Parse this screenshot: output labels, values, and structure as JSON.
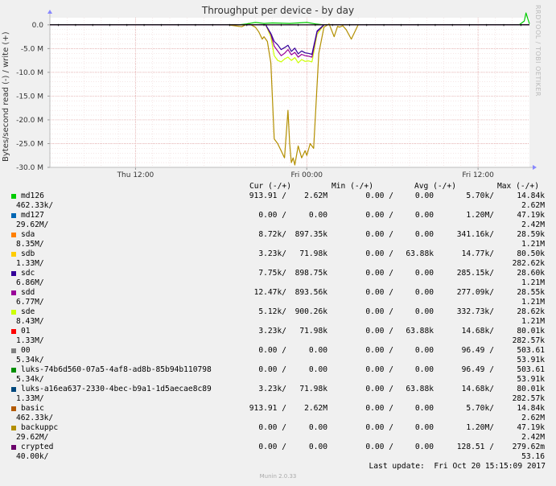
{
  "title": "Throughput per device - by day",
  "watermark": "RRDTOOL / TOBI OETIKER",
  "footer": "Munin 2.0.33",
  "last_update": "Last update:  Fri Oct 20 15:15:09 2017",
  "legend_headers": {
    "cur": "Cur (-/+)",
    "min": "Min (-/+)",
    "avg": "Avg (-/+)",
    "max": "Max (-/+)"
  },
  "legend": [
    {
      "name": "md126",
      "color": "#00cc00",
      "cur": "913.91 /",
      "cur2": "2.62M",
      "min": "0.00 /",
      "min2": "0.00",
      "avg": "5.70k/",
      "max": "14.84k",
      "cont_left": "462.33k/",
      "cont_right": "2.62M"
    },
    {
      "name": "md127",
      "color": "#0066b3",
      "cur": "0.00 /",
      "cur2": "0.00",
      "min": "0.00 /",
      "min2": "0.00",
      "avg": "1.20M/",
      "max": "47.19k",
      "cont_left": "29.62M/",
      "cont_right": "2.42M"
    },
    {
      "name": "sda",
      "color": "#ff8000",
      "cur": "8.72k/",
      "cur2": "897.35k",
      "min": "0.00 /",
      "min2": "0.00",
      "avg": "341.16k/",
      "max": "28.59k",
      "cont_left": "8.35M/",
      "cont_right": "1.21M"
    },
    {
      "name": "sdb",
      "color": "#ffcc00",
      "cur": "3.23k/",
      "cur2": "71.98k",
      "min": "0.00 /",
      "min2": "63.88k",
      "avg": "14.77k/",
      "max": "80.50k",
      "cont_left": "1.33M/",
      "cont_right": "282.62k"
    },
    {
      "name": "sdc",
      "color": "#330099",
      "cur": "7.75k/",
      "cur2": "898.75k",
      "min": "0.00 /",
      "min2": "0.00",
      "avg": "285.15k/",
      "max": "28.60k",
      "cont_left": "6.86M/",
      "cont_right": "1.21M"
    },
    {
      "name": "sdd",
      "color": "#990099",
      "cur": "12.47k/",
      "cur2": "893.56k",
      "min": "0.00 /",
      "min2": "0.00",
      "avg": "277.09k/",
      "max": "28.55k",
      "cont_left": "6.77M/",
      "cont_right": "1.21M"
    },
    {
      "name": "sde",
      "color": "#ccff00",
      "cur": "5.12k/",
      "cur2": "900.26k",
      "min": "0.00 /",
      "min2": "0.00",
      "avg": "332.73k/",
      "max": "28.62k",
      "cont_left": "8.43M/",
      "cont_right": "1.21M"
    },
    {
      "name": "01",
      "color": "#ff0000",
      "cur": "3.23k/",
      "cur2": "71.98k",
      "min": "0.00 /",
      "min2": "63.88k",
      "avg": "14.68k/",
      "max": "80.01k",
      "cont_left": "1.33M/",
      "cont_right": "282.57k"
    },
    {
      "name": "00",
      "color": "#808080",
      "cur": "0.00 /",
      "cur2": "0.00",
      "min": "0.00 /",
      "min2": "0.00",
      "avg": "96.49 /",
      "max": "503.61",
      "cont_left": "5.34k/",
      "cont_right": "53.91k"
    },
    {
      "name": "luks-74b6d560-07a5-4af8-ad8b-85b94b110798",
      "color": "#008f00",
      "cur": "0.00 /",
      "cur2": "0.00",
      "min": "0.00 /",
      "min2": "0.00",
      "avg": "96.49 /",
      "max": "503.61",
      "cont_left": "5.34k/",
      "cont_right": "53.91k"
    },
    {
      "name": "luks-a16ea637-2330-4bec-b9a1-1d5aecae8c89",
      "color": "#00487d",
      "cur": "3.23k/",
      "cur2": "71.98k",
      "min": "0.00 /",
      "min2": "63.88k",
      "avg": "14.68k/",
      "max": "80.01k",
      "cont_left": "1.33M/",
      "cont_right": "282.57k"
    },
    {
      "name": "basic",
      "color": "#b35a00",
      "cur": "913.91 /",
      "cur2": "2.62M",
      "min": "0.00 /",
      "min2": "0.00",
      "avg": "5.70k/",
      "max": "14.84k",
      "cont_left": "462.33k/",
      "cont_right": "2.62M"
    },
    {
      "name": "backuppc",
      "color": "#b38f00",
      "cur": "0.00 /",
      "cur2": "0.00",
      "min": "0.00 /",
      "min2": "0.00",
      "avg": "1.20M/",
      "max": "47.19k",
      "cont_left": "29.62M/",
      "cont_right": "2.42M"
    },
    {
      "name": "crypted",
      "color": "#6b006b",
      "cur": "0.00 /",
      "cur2": "0.00",
      "min": "0.00 /",
      "min2": "0.00",
      "avg": "128.51 /",
      "max": "279.62m",
      "cont_left": "40.00k/",
      "cont_right": "53.16"
    }
  ],
  "chart_data": {
    "type": "line",
    "title": "Throughput per device - by day",
    "ylabel": "Bytes/second read (-) / write (+)",
    "xlabel": "",
    "ylim": [
      -30,
      1.5
    ],
    "y_unit": "M",
    "yticks": [
      {
        "value": 0,
        "label": "0.0"
      },
      {
        "value": -5,
        "label": "-5.0 M"
      },
      {
        "value": -10,
        "label": "-10.0 M"
      },
      {
        "value": -15,
        "label": "-15.0 M"
      },
      {
        "value": -20,
        "label": "-20.0 M"
      },
      {
        "value": -25,
        "label": "-25.0 M"
      },
      {
        "value": -30,
        "label": "-30.0 M"
      }
    ],
    "xlim": [
      0,
      28
    ],
    "xticks": [
      {
        "value": 5,
        "label": "Thu 12:00"
      },
      {
        "value": 15,
        "label": "Fri 00:00"
      },
      {
        "value": 25,
        "label": "Fri 12:00"
      }
    ],
    "grid": true,
    "series": [
      {
        "name": "backuppc",
        "color": "#b38f00",
        "x": [
          0,
          10.0,
          10.4,
          10.8,
          11.2,
          11.6,
          12.0,
          12.2,
          12.4,
          12.5,
          12.7,
          12.9,
          13.1,
          13.3,
          13.5,
          13.7,
          13.9,
          14.0,
          14.1,
          14.2,
          14.3,
          14.5,
          14.7,
          14.9,
          15.0,
          15.2,
          15.4,
          15.7,
          16.0,
          16.3,
          16.6,
          16.8,
          16.9,
          17.1,
          17.3,
          17.6,
          18.0,
          20.0,
          24.0,
          28.0
        ],
        "y": [
          0,
          0,
          0,
          -0.2,
          -0.4,
          0.3,
          -0.5,
          -1.5,
          -3.0,
          -2.5,
          -3.5,
          -8.0,
          -24.0,
          -25.0,
          -26.5,
          -28.0,
          -18.0,
          -25.0,
          -29.0,
          -28.0,
          -29.5,
          -25.5,
          -28.0,
          -26.5,
          -27.5,
          -25.0,
          -26.0,
          -6.0,
          -0.5,
          0.2,
          -2.5,
          -0.3,
          -0.5,
          -0.2,
          -1.0,
          -3.0,
          0,
          0,
          0,
          0
        ]
      },
      {
        "name": "sde",
        "color": "#ccff00",
        "x": [
          0,
          12.6,
          12.9,
          13.1,
          13.3,
          13.5,
          13.7,
          13.9,
          14.1,
          14.3,
          14.5,
          14.7,
          14.9,
          15.1,
          15.3,
          15.6,
          16.0,
          28.0
        ],
        "y": [
          0,
          0,
          -2.5,
          -6.5,
          -7.5,
          -7.8,
          -7.2,
          -6.8,
          -7.5,
          -6.9,
          -8.0,
          -7.3,
          -7.7,
          -7.6,
          -7.8,
          -2.0,
          0,
          0
        ]
      },
      {
        "name": "sdd",
        "color": "#990099",
        "x": [
          0,
          12.6,
          12.9,
          13.1,
          13.3,
          13.5,
          13.7,
          13.9,
          14.1,
          14.3,
          14.5,
          14.7,
          14.9,
          15.1,
          15.3,
          15.6,
          16.0,
          28.0
        ],
        "y": [
          0,
          0,
          -2.0,
          -4.5,
          -5.5,
          -6.5,
          -6.0,
          -5.2,
          -6.3,
          -5.8,
          -6.8,
          -6.2,
          -6.5,
          -6.6,
          -6.8,
          -1.5,
          0,
          0
        ]
      },
      {
        "name": "sdc",
        "color": "#330099",
        "x": [
          0,
          12.6,
          12.9,
          13.1,
          13.3,
          13.5,
          13.7,
          13.9,
          14.1,
          14.3,
          14.5,
          14.7,
          14.9,
          15.1,
          15.3,
          15.6,
          16.0,
          28.0
        ],
        "y": [
          0,
          0,
          -1.8,
          -3.5,
          -4.2,
          -5.2,
          -4.8,
          -4.3,
          -5.6,
          -4.9,
          -6.1,
          -5.5,
          -5.9,
          -6.0,
          -6.2,
          -1.3,
          0,
          0
        ]
      },
      {
        "name": "md126",
        "color": "#00cc00",
        "x": [
          0,
          11.0,
          11.5,
          12.0,
          12.5,
          13.0,
          14.0,
          15.0,
          15.5,
          16.0,
          27.4,
          27.7,
          27.8,
          28.0
        ],
        "y": [
          0,
          0,
          0.2,
          0.5,
          0.3,
          0.4,
          0.3,
          0.5,
          0.2,
          0,
          0,
          0.8,
          2.5,
          0.2
        ]
      },
      {
        "name": "crypted",
        "color": "#6b006b",
        "x": [
          0,
          28.0
        ],
        "y": [
          0,
          0
        ]
      }
    ]
  }
}
